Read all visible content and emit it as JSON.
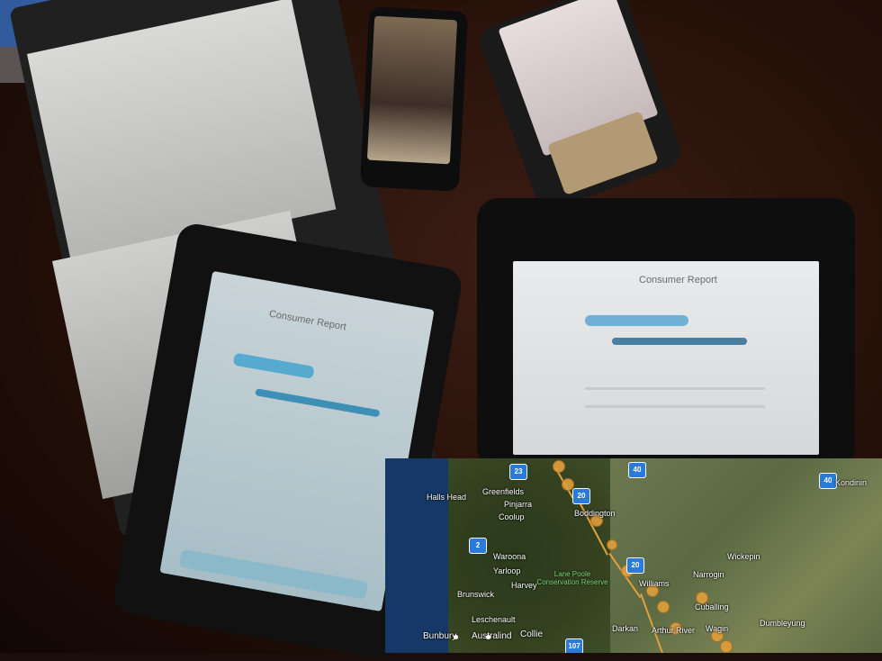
{
  "scene": {
    "description_colors": {
      "table": "#241008",
      "laptop_screen": "#c8c8c6",
      "map_sea": "#163866",
      "route": "#e0a03c",
      "shield": "#2a7bd9"
    }
  },
  "tablet_left": {
    "title": "Consumer Report"
  },
  "tablet_right": {
    "title": "Consumer Report"
  },
  "map": {
    "places": [
      {
        "name": "Halls Head"
      },
      {
        "name": "Greenfields"
      },
      {
        "name": "Pinjarra"
      },
      {
        "name": "Coolup"
      },
      {
        "name": "Waroona"
      },
      {
        "name": "Yarloop"
      },
      {
        "name": "Harvey"
      },
      {
        "name": "Brunswick"
      },
      {
        "name": "Leschenault"
      },
      {
        "name": "Bunbury"
      },
      {
        "name": "Australind"
      },
      {
        "name": "Collie"
      },
      {
        "name": "Boddington"
      },
      {
        "name": "Williams"
      },
      {
        "name": "Wickepin"
      },
      {
        "name": "Narrogin"
      },
      {
        "name": "Cuballing"
      },
      {
        "name": "Darkan"
      },
      {
        "name": "Arthur River"
      },
      {
        "name": "Wagin"
      },
      {
        "name": "Dumbleyung"
      },
      {
        "name": "Kondinin"
      }
    ],
    "reserve": "Lane Poole Conservation Reserve",
    "routes": [
      "23",
      "40",
      "20",
      "2",
      "107",
      "40"
    ]
  }
}
